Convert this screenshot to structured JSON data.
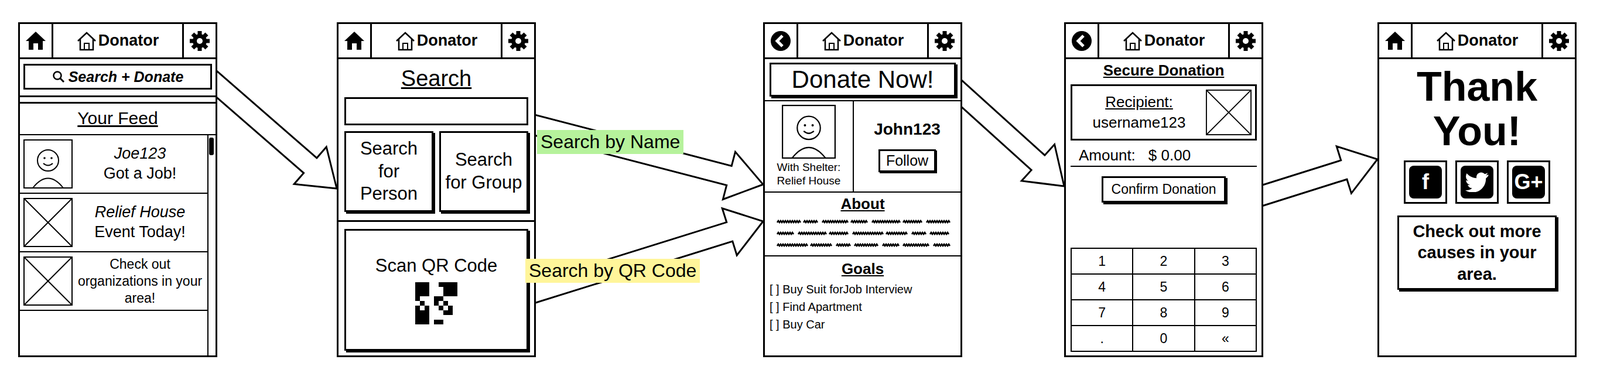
{
  "logo": "Donator",
  "feed": {
    "nav": "home",
    "search_button": "Search + Donate",
    "title": "Your Feed",
    "items": [
      {
        "kind": "avatar",
        "name": "Joe123",
        "text": "Got a Job!"
      },
      {
        "kind": "image",
        "name": "Relief House",
        "text": "Event Today!"
      },
      {
        "kind": "image",
        "text": "Check out organizations in your area!"
      }
    ],
    "scrollbar": {
      "level": 0
    }
  },
  "search": {
    "nav": "home",
    "title": "Search",
    "buttons": [
      "Search for Person",
      "Search for Group"
    ],
    "qr": "Scan QR Code"
  },
  "profile": {
    "nav": "back",
    "donate": "Donate Now!",
    "affiliation": [
      "With Shelter:",
      "Relief House"
    ],
    "username": "John123",
    "follow": "Follow",
    "about_title": "About",
    "goals_title": "Goals",
    "goals": [
      "[ ] Buy Suit forJob Interview",
      "[ ] Find Apartment",
      "[ ] Buy Car"
    ]
  },
  "donation": {
    "nav": "back",
    "title": "Secure Donation",
    "recipient_label": "Recipient:",
    "recipient": "username123",
    "amount_label": "Amount:",
    "amount": "$ 0.00",
    "confirm": "Confirm Donation",
    "keys": [
      "1",
      "2",
      "3",
      "4",
      "5",
      "6",
      "7",
      "8",
      "9",
      ".",
      "0",
      "«"
    ]
  },
  "thanks": {
    "nav": "home",
    "title": "Thank You!",
    "social": [
      {
        "kind": "glyph",
        "glyph": "f"
      },
      {
        "kind": "bird"
      },
      {
        "kind": "glyph",
        "glyph": "G+"
      }
    ],
    "more": "Check out more causes in your area."
  },
  "connectors": [
    {
      "label": "Search by Name",
      "color": "#b6f29c"
    },
    {
      "label": "Search by QR Code",
      "color": "#fff59a"
    }
  ]
}
